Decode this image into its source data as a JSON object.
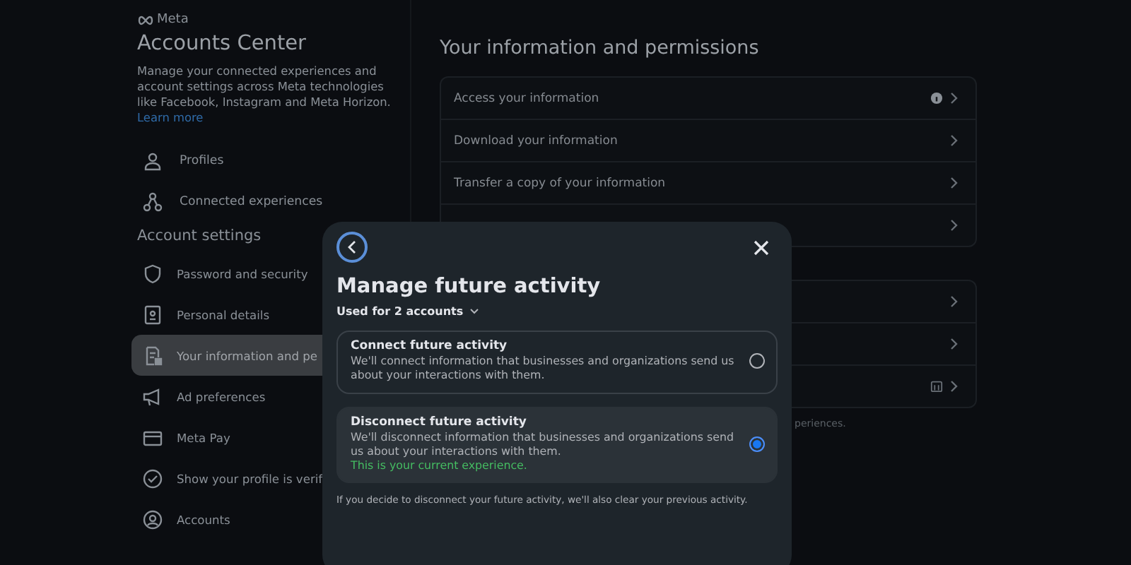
{
  "brand": "Meta",
  "sidebar": {
    "title": "Accounts Center",
    "description": "Manage your connected experiences and account settings across Meta technologies like Facebook, Instagram and Meta Horizon.",
    "link": "Learn more",
    "nav": [
      {
        "label": "Profiles"
      },
      {
        "label": "Connected experiences"
      }
    ],
    "section_title": "Account settings",
    "settings": [
      {
        "label": "Password and security",
        "selected": false
      },
      {
        "label": "Personal details",
        "selected": false
      },
      {
        "label": "Your information and pe",
        "selected": true
      },
      {
        "label": "Ad preferences",
        "selected": false
      },
      {
        "label": "Meta Pay",
        "selected": false
      },
      {
        "label": "Show your profile is verif",
        "selected": false
      },
      {
        "label": "Accounts",
        "selected": false
      }
    ]
  },
  "main": {
    "title": "Your information and permissions",
    "cards": [
      {
        "rows": [
          {
            "kind": "info",
            "label": "Access your information"
          },
          {
            "kind": "plain",
            "label": "Download your information"
          },
          {
            "kind": "plain",
            "label": "Transfer a copy of your information"
          },
          {
            "kind": "plain"
          }
        ]
      },
      {
        "rows": [
          {
            "kind": "plain"
          },
          {
            "kind": "plain"
          },
          {
            "kind": "calendar"
          }
        ]
      }
    ],
    "note": "periences."
  },
  "modal": {
    "title": "Manage future activity",
    "scope": "Used for 2 accounts",
    "options": [
      {
        "title": "Connect future activity",
        "description": "We'll connect information that businesses and organizations send us about your interactions with them.",
        "selected": false
      },
      {
        "title": "Disconnect future activity",
        "description": "We'll disconnect information that businesses and organizations send us about your interactions with them.",
        "status": "This is your current experience.",
        "selected": true
      }
    ],
    "footer": "If you decide to disconnect your future activity, we'll also clear your previous activity."
  }
}
